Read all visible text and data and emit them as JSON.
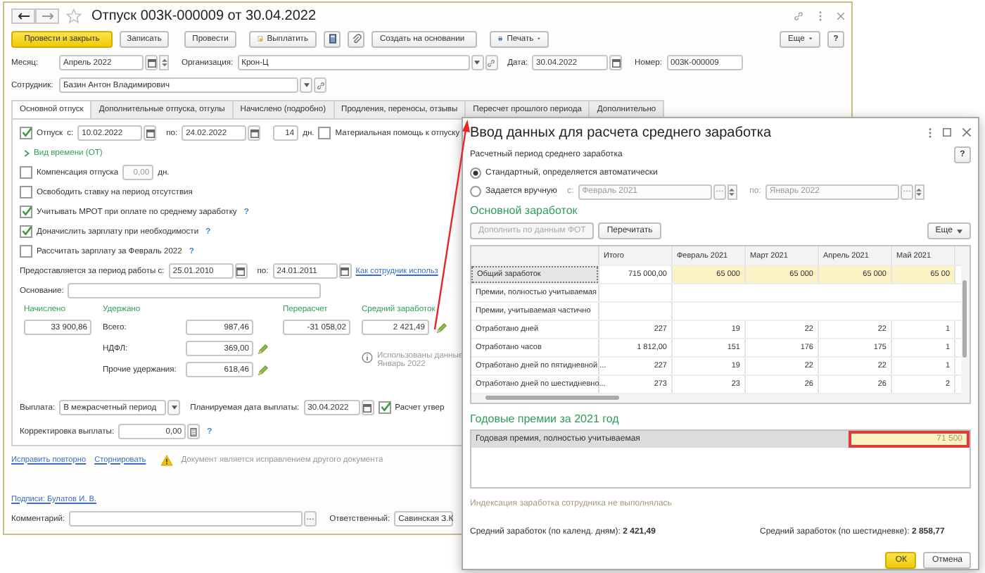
{
  "window": {
    "title": "Отпуск 003К-000009 от 30.04.2022",
    "favorite": false
  },
  "toolbar": {
    "post_close": "Провести и закрыть",
    "save": "Записать",
    "post": "Провести",
    "pay": "Выплатить",
    "create_based_on": "Создать на основании",
    "print": "Печать",
    "more": "Еще",
    "help": "?"
  },
  "header": {
    "month": {
      "label": "Месяц:",
      "value": "Апрель 2022"
    },
    "organization": {
      "label": "Организация:",
      "value": "Крон-Ц"
    },
    "date": {
      "label": "Дата:",
      "value": "30.04.2022"
    },
    "number": {
      "label": "Номер:",
      "value": "003К-000009"
    },
    "employee": {
      "label": "Сотрудник:",
      "value": "Базин Антон Владимирович"
    }
  },
  "tabs": [
    {
      "label": "Основной отпуск",
      "selected": true
    },
    {
      "label": "Дополнительные отпуска, отгулы",
      "selected": false
    },
    {
      "label": "Начислено (подробно)",
      "selected": false
    },
    {
      "label": "Продления, переносы, отзывы",
      "selected": false
    },
    {
      "label": "Пересчет прошлого периода",
      "selected": false
    },
    {
      "label": "Дополнительно",
      "selected": false
    }
  ],
  "main": {
    "leave": {
      "checked": true,
      "label": "Отпуск",
      "from_label": "с:",
      "from": "10.02.2022",
      "to_label": "по:",
      "to": "24.02.2022",
      "days": "14",
      "days_unit": "дн."
    },
    "material_aid": {
      "checked": false,
      "label": "Материальная помощь к отпуску"
    },
    "time_type": {
      "label": "Вид времени (ОТ)",
      "expanded": false
    },
    "compensation": {
      "checked": false,
      "label": "Компенсация отпуска",
      "value": "0,00",
      "unit": "дн.",
      "disabled": true
    },
    "options": [
      {
        "label": "Освободить ставку на период отсутствия",
        "checked": false
      },
      {
        "label": "Учитывать МРОТ при оплате по среднему заработку",
        "checked": true,
        "help": "?"
      },
      {
        "label": "Доначислить зарплату при необходимости",
        "checked": true,
        "help": "?"
      },
      {
        "label": "Рассчитать зарплату за Февраль 2022",
        "checked": false,
        "help": "?"
      }
    ],
    "work_period": {
      "label": "Предоставляется за период работы с:",
      "from": "25.01.2010",
      "to_label": "по:",
      "to": "24.01.2011",
      "link": "Как сотрудник использ"
    },
    "basis": {
      "label": "Основание:"
    },
    "totals": {
      "accrued": {
        "label": "Начислено",
        "value": "33 900,86"
      },
      "withheld": {
        "label": "Удержано",
        "rows": [
          {
            "label": "Всего:",
            "value": "987,46",
            "editable": false
          },
          {
            "label": "НДФЛ:",
            "value": "369,00",
            "editable": true
          },
          {
            "label": "Прочие удержания:",
            "value": "618,46",
            "editable": true
          }
        ]
      },
      "recalc": {
        "label": "Перерасчет",
        "value": "-31 058,02"
      },
      "average": {
        "label": "Средний заработок",
        "value": "2 421,49"
      },
      "note": [
        "Использованы данные",
        "Январь 2022"
      ]
    },
    "payment": {
      "label": "Выплата:",
      "value": "В межрасчетный период",
      "planned_label": "Планируемая дата выплаты:",
      "planned": "30.04.2022",
      "approved": {
        "checked": true,
        "label": "Расчет утвер"
      }
    },
    "correction": {
      "label": "Корректировка выплаты:",
      "value": "0,00",
      "help": "?"
    }
  },
  "footer": {
    "links": [
      "Исправить повторно",
      "Сторнировать"
    ],
    "warning": "Документ является исправлением другого документа",
    "signatures": "Подписи: Булатов И. В.",
    "comment_label": "Комментарий:",
    "responsible_label": "Ответственный:",
    "responsible": "Савинская З.К"
  },
  "dialog": {
    "title": "Ввод данных для расчета среднего заработка",
    "help": "?",
    "period_label": "Расчетный период среднего заработка",
    "period_options": [
      {
        "label": "Стандартный, определяется автоматически",
        "selected": true
      },
      {
        "label": "Задается вручную",
        "selected": false
      }
    ],
    "manual": {
      "from_label": "с:",
      "from": "Февраль 2021",
      "to_label": "по:",
      "to": "Январь 2022",
      "disabled": true
    },
    "earnings_title": "Основной заработок",
    "buttons": [
      {
        "label": "Дополнить по данным ФОТ",
        "disabled": true
      },
      {
        "label": "Перечитать",
        "disabled": false
      }
    ],
    "more": "Еще",
    "columns": [
      "Итого",
      "Февраль 2021",
      "Март 2021",
      "Апрель 2021",
      "Май 2021"
    ],
    "rows": [
      {
        "label": "Общий заработок",
        "total": "715 000,00",
        "values": [
          "65 000",
          "65 000",
          "65 000",
          "65 00"
        ],
        "selected": true,
        "highlighted": true
      },
      {
        "label": "Премии, полностью учитываемая",
        "selected": false
      },
      {
        "label": "Премии, учитываемая частично",
        "selected": false
      },
      {
        "label": "Отработано дней",
        "total": "227",
        "values": [
          "19",
          "22",
          "22",
          "1"
        ],
        "selected": false,
        "highlighted": false
      },
      {
        "label": "Отработано часов",
        "total": "1 812,00",
        "values": [
          "151",
          "176",
          "175",
          "1"
        ],
        "selected": false,
        "highlighted": false
      },
      {
        "label": "Отработано дней по пятидневной ...",
        "total": "227",
        "values": [
          "19",
          "22",
          "22",
          "1"
        ],
        "selected": false,
        "highlighted": false
      },
      {
        "label": "Отработано дней по шестидневно...",
        "total": "273",
        "values": [
          "23",
          "26",
          "26",
          "2"
        ],
        "selected": false,
        "highlighted": false
      }
    ],
    "bonus_title": "Годовые премии за 2021 год",
    "bonus_rows": [
      {
        "label": "Годовая премия, полностью учитываемая",
        "value": "71 500",
        "outlined": true
      }
    ],
    "indexation": "Индексация заработка сотрудника не выполнялась",
    "averages": [
      {
        "label": "Средний заработок (по календ. дням):",
        "value": "2 421,49"
      },
      {
        "label": "Средний заработок (по шестидневке):",
        "value": "2 858,77"
      }
    ],
    "ok": "ОК",
    "cancel": "Отмена"
  }
}
